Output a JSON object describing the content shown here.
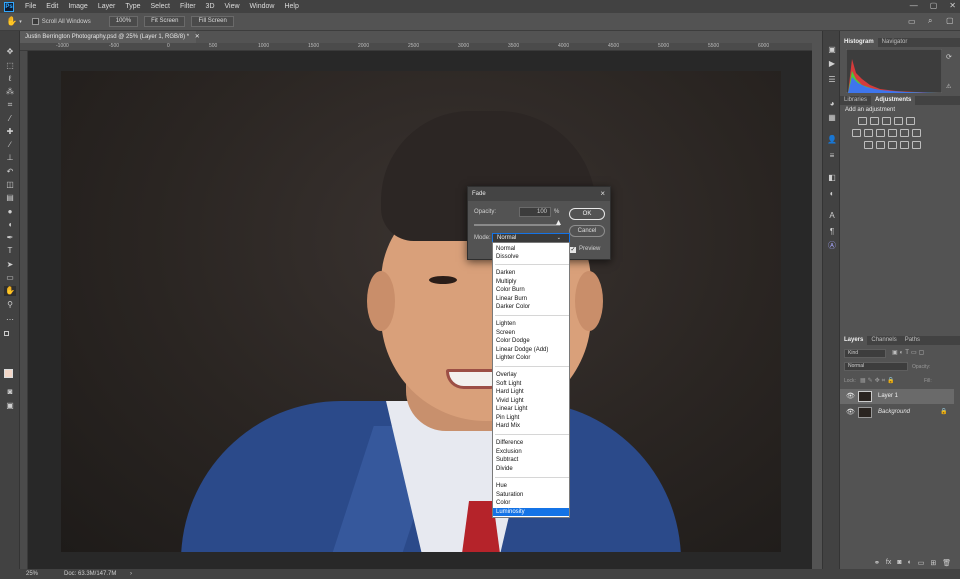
{
  "app": {
    "logo": "Ps"
  },
  "menu": [
    "File",
    "Edit",
    "Image",
    "Layer",
    "Type",
    "Select",
    "Filter",
    "3D",
    "View",
    "Window",
    "Help"
  ],
  "window_controls": [
    "—",
    "▢",
    "✕"
  ],
  "options": {
    "scroll_all": "Scroll All Windows",
    "zoom100": "100%",
    "fit1": "Fit Screen",
    "fit2": "Fill Screen"
  },
  "document": {
    "tab_title": "Justin Berrington Photography.psd @ 25% (Layer 1, RGB/8) *"
  },
  "ruler_ticks": [
    "-1000",
    "-500",
    "0",
    "500",
    "1000",
    "1500",
    "2000",
    "2500",
    "3000",
    "3500",
    "4000",
    "4500",
    "5000",
    "5500",
    "6000"
  ],
  "status": {
    "zoom": "25%",
    "doc": "Doc: 63.3M/147.7M"
  },
  "histogram_panel": {
    "tabs": [
      "Histogram",
      "Navigator"
    ]
  },
  "adjustments_panel": {
    "tabs": [
      "Libraries",
      "Adjustments"
    ],
    "heading": "Add an adjustment"
  },
  "layers_panel": {
    "tabs": [
      "Layers",
      "Channels",
      "Paths"
    ],
    "kind": "Kind",
    "blend": "Normal",
    "opacity_label": "Opacity:",
    "lock_label": "Lock:",
    "fill_label": "Fill:",
    "layers": [
      {
        "name": "Layer 1",
        "selected": true
      },
      {
        "name": "Background",
        "selected": false
      }
    ]
  },
  "fade_dialog": {
    "title": "Fade",
    "opacity_label": "Opacity:",
    "opacity_value": "100",
    "opacity_unit": "%",
    "mode_label": "Mode:",
    "mode_value": "Normal",
    "ok": "OK",
    "cancel": "Cancel",
    "preview": "Preview",
    "preview_checked": true
  },
  "blend_modes": [
    [
      "Normal",
      "Dissolve"
    ],
    [
      "Darken",
      "Multiply",
      "Color Burn",
      "Linear Burn",
      "Darker Color"
    ],
    [
      "Lighten",
      "Screen",
      "Color Dodge",
      "Linear Dodge (Add)",
      "Lighter Color"
    ],
    [
      "Overlay",
      "Soft Light",
      "Hard Light",
      "Vivid Light",
      "Linear Light",
      "Pin Light",
      "Hard Mix"
    ],
    [
      "Difference",
      "Exclusion",
      "Subtract",
      "Divide"
    ],
    [
      "Hue",
      "Saturation",
      "Color",
      "Luminosity"
    ]
  ],
  "blend_mode_highlighted": "Luminosity",
  "colors": {
    "accent": "#1473e6",
    "panel": "#535353",
    "dark": "#424242"
  }
}
